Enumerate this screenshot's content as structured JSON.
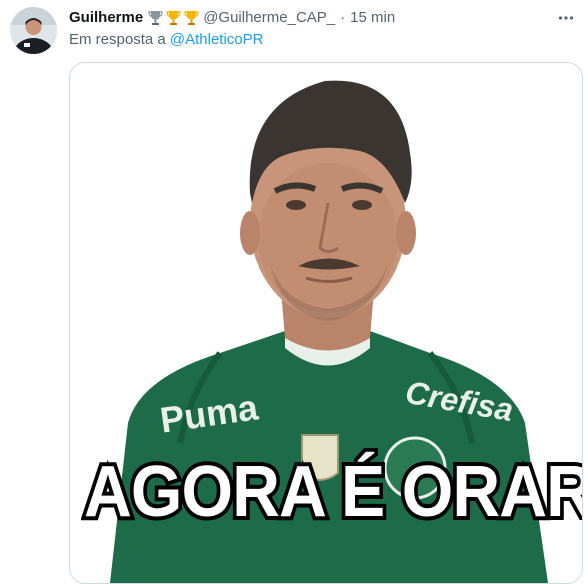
{
  "tweet": {
    "author_name": "Guilherme",
    "badges": [
      "trophy-silver-icon",
      "trophy-gold-icon",
      "trophy-gold-icon"
    ],
    "handle": "@Guilherme_CAP_",
    "separator": "·",
    "time": "15 min",
    "reply_prefix": "Em resposta a",
    "reply_to": "@AthleticoPR",
    "more_icon": "more-icon"
  },
  "media": {
    "caption": "AGORA É ORAR",
    "jersey_text": [
      "Puma",
      "Crefisa"
    ]
  },
  "colors": {
    "link": "#1d9bf0",
    "muted": "#536471",
    "jersey_green": "#1d6b48",
    "border": "#cfd9de"
  }
}
